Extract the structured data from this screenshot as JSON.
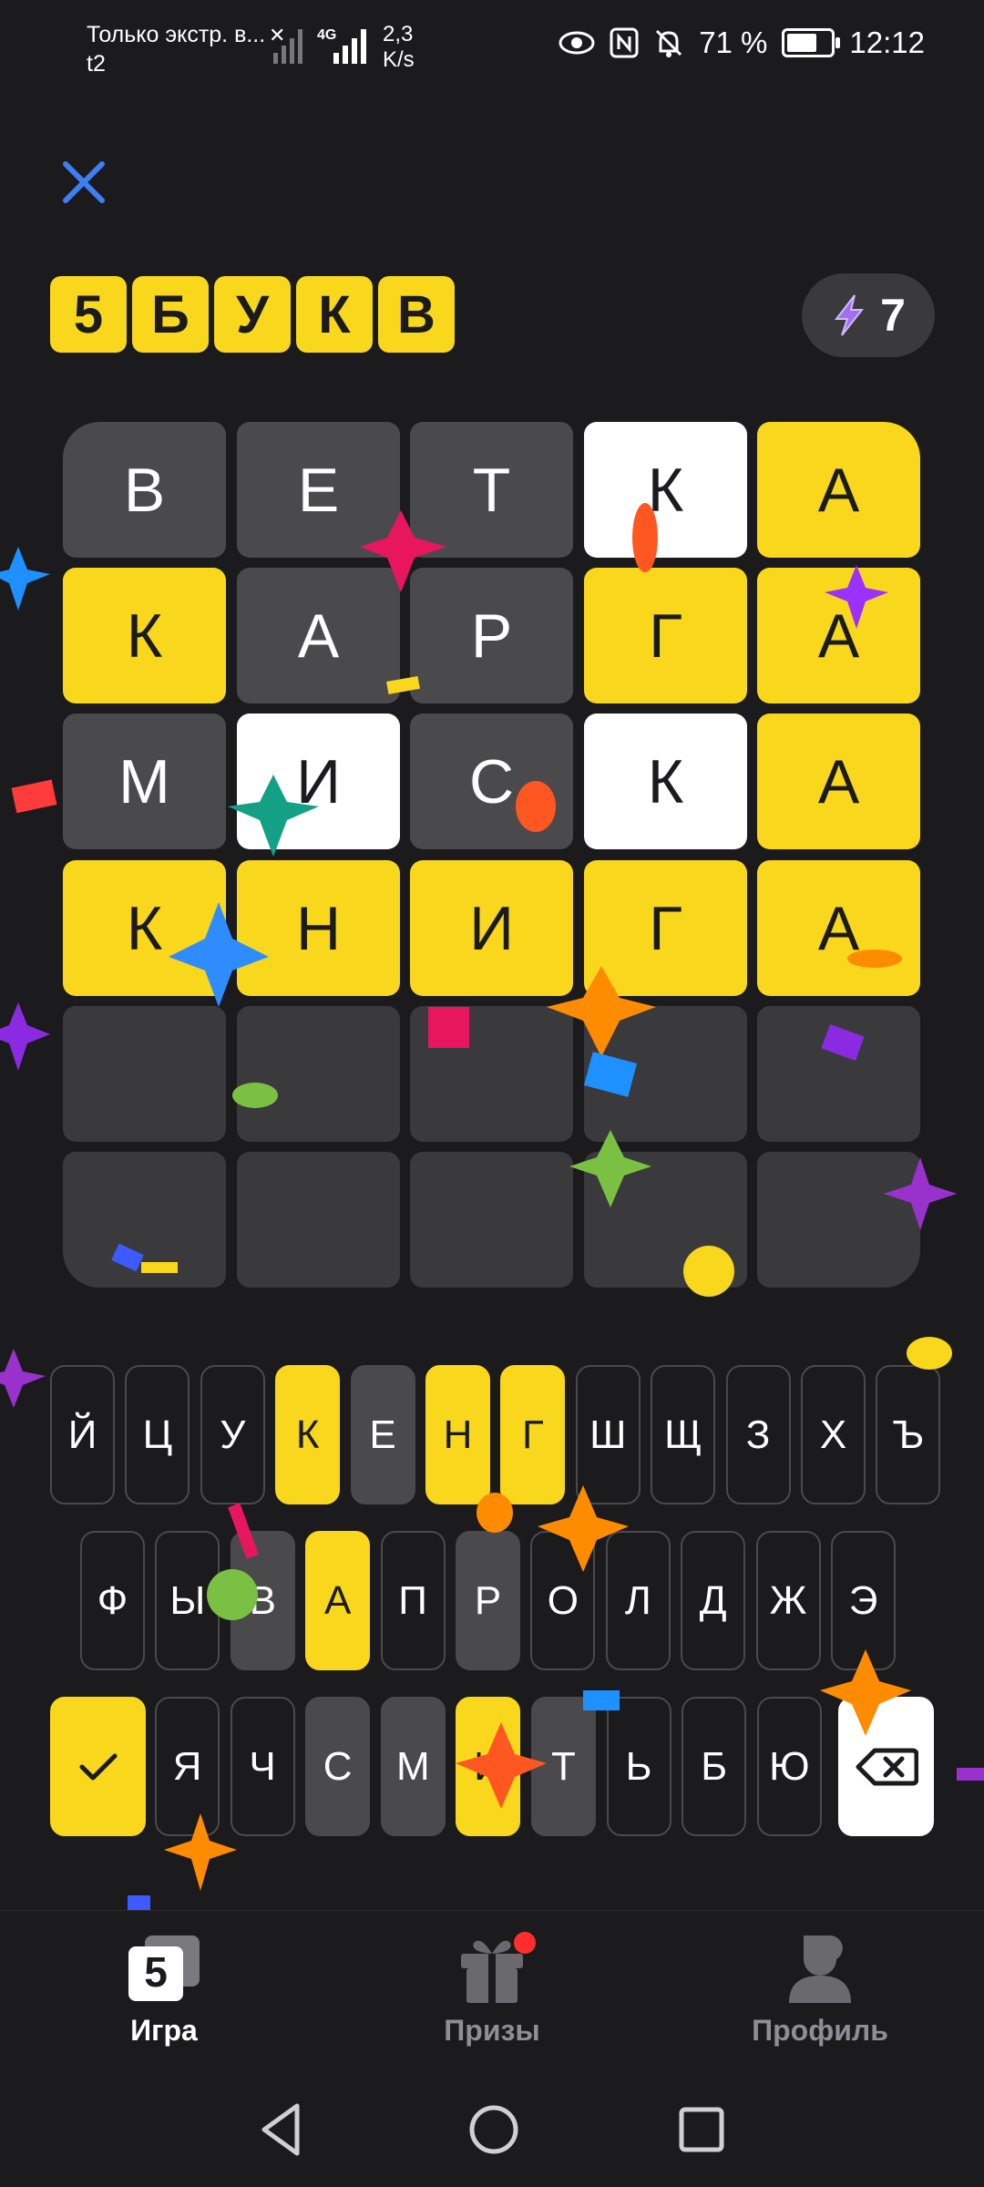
{
  "status_bar": {
    "carrier_line1": "Только экстр. в...",
    "carrier_line2": "t2",
    "network": "4G",
    "speed_value": "2,3",
    "speed_unit": "K/s",
    "battery": "71 %",
    "time": "12:12"
  },
  "header": {
    "logo_letters": [
      "5",
      "Б",
      "У",
      "К",
      "В"
    ],
    "energy_count": "7"
  },
  "board": {
    "rows": [
      [
        {
          "l": "В",
          "s": "gray"
        },
        {
          "l": "Е",
          "s": "gray"
        },
        {
          "l": "Т",
          "s": "gray"
        },
        {
          "l": "К",
          "s": "white"
        },
        {
          "l": "А",
          "s": "yellow"
        }
      ],
      [
        {
          "l": "К",
          "s": "yellow"
        },
        {
          "l": "А",
          "s": "gray"
        },
        {
          "l": "Р",
          "s": "gray"
        },
        {
          "l": "Г",
          "s": "yellow"
        },
        {
          "l": "А",
          "s": "yellow"
        }
      ],
      [
        {
          "l": "М",
          "s": "gray"
        },
        {
          "l": "И",
          "s": "white"
        },
        {
          "l": "С",
          "s": "gray"
        },
        {
          "l": "К",
          "s": "white"
        },
        {
          "l": "А",
          "s": "yellow"
        }
      ],
      [
        {
          "l": "К",
          "s": "yellow"
        },
        {
          "l": "Н",
          "s": "yellow"
        },
        {
          "l": "И",
          "s": "yellow"
        },
        {
          "l": "Г",
          "s": "yellow"
        },
        {
          "l": "А",
          "s": "yellow"
        }
      ],
      [
        {
          "l": "",
          "s": "empty"
        },
        {
          "l": "",
          "s": "empty"
        },
        {
          "l": "",
          "s": "empty"
        },
        {
          "l": "",
          "s": "empty"
        },
        {
          "l": "",
          "s": "empty"
        }
      ],
      [
        {
          "l": "",
          "s": "empty"
        },
        {
          "l": "",
          "s": "empty"
        },
        {
          "l": "",
          "s": "empty"
        },
        {
          "l": "",
          "s": "empty"
        },
        {
          "l": "",
          "s": "empty"
        }
      ]
    ]
  },
  "keyboard": {
    "row1": [
      {
        "k": "Й",
        "s": "unused"
      },
      {
        "k": "Ц",
        "s": "unused"
      },
      {
        "k": "У",
        "s": "unused"
      },
      {
        "k": "К",
        "s": "yellow"
      },
      {
        "k": "Е",
        "s": "gray"
      },
      {
        "k": "Н",
        "s": "yellow"
      },
      {
        "k": "Г",
        "s": "yellow"
      },
      {
        "k": "Ш",
        "s": "unused"
      },
      {
        "k": "Щ",
        "s": "unused"
      },
      {
        "k": "З",
        "s": "unused"
      },
      {
        "k": "Х",
        "s": "unused"
      },
      {
        "k": "Ъ",
        "s": "unused"
      }
    ],
    "row2": [
      {
        "k": "Ф",
        "s": "unused"
      },
      {
        "k": "Ы",
        "s": "unused"
      },
      {
        "k": "В",
        "s": "gray"
      },
      {
        "k": "А",
        "s": "yellow"
      },
      {
        "k": "П",
        "s": "unused"
      },
      {
        "k": "Р",
        "s": "gray"
      },
      {
        "k": "О",
        "s": "unused"
      },
      {
        "k": "Л",
        "s": "unused"
      },
      {
        "k": "Д",
        "s": "unused"
      },
      {
        "k": "Ж",
        "s": "unused"
      },
      {
        "k": "Э",
        "s": "unused"
      }
    ],
    "row3": [
      {
        "k": "Я",
        "s": "unused"
      },
      {
        "k": "Ч",
        "s": "unused"
      },
      {
        "k": "С",
        "s": "gray"
      },
      {
        "k": "М",
        "s": "gray"
      },
      {
        "k": "И",
        "s": "yellow"
      },
      {
        "k": "Т",
        "s": "gray"
      },
      {
        "k": "Ь",
        "s": "unused"
      },
      {
        "k": "Б",
        "s": "unused"
      },
      {
        "k": "Ю",
        "s": "unused"
      }
    ]
  },
  "bottom_nav": {
    "items": [
      {
        "label": "Игра",
        "icon": "game-icon",
        "active": true
      },
      {
        "label": "Призы",
        "icon": "gift-icon",
        "active": false,
        "badge": true
      },
      {
        "label": "Профиль",
        "icon": "profile-icon",
        "active": false
      }
    ]
  },
  "colors": {
    "background": "#1b1b1d",
    "yellow": "#f9d71c",
    "gray": "#4a4a4c",
    "empty": "#3a3a3c",
    "close_blue": "#3d7ff5",
    "badge_red": "#ff2d2d",
    "energy_purple": "#a070f0"
  }
}
